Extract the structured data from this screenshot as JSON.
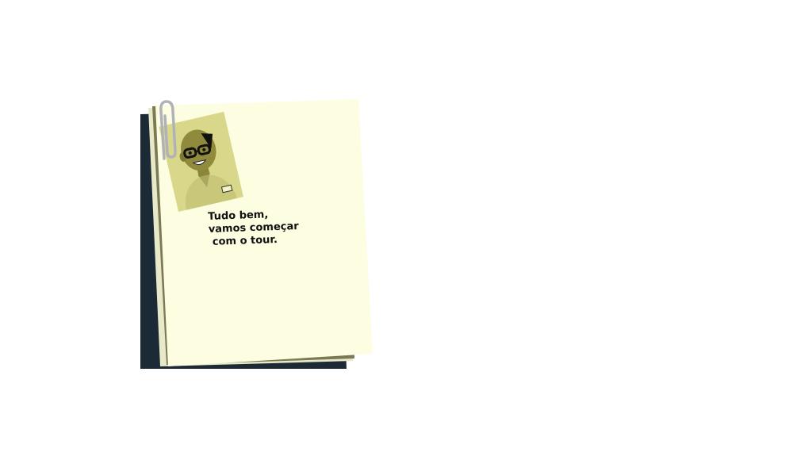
{
  "note": {
    "lines": [
      "Tudo bem,",
      "vamos começar",
      " com o tour."
    ]
  },
  "photo": {
    "badge_text": "CLT"
  },
  "colors": {
    "note_paper": "#fdfee1",
    "note_shadow": "#1b2a35",
    "photo_bg": "#d9d88a",
    "character_skin": "#8f8a3c",
    "paperclip": "#b0b2b8"
  }
}
